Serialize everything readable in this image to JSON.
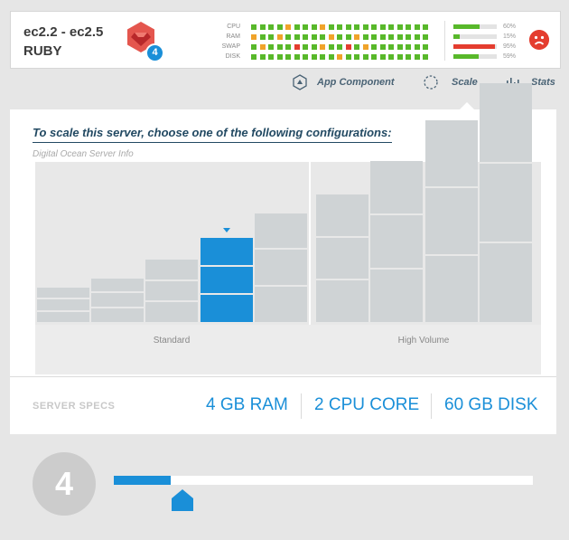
{
  "server": {
    "name": "ec2.2 - ec2.5",
    "language": "RUBY",
    "instance_count": "4"
  },
  "metrics": [
    {
      "label": "CPU",
      "dots": [
        "g",
        "g",
        "g",
        "g",
        "o",
        "g",
        "g",
        "g",
        "o",
        "g",
        "g",
        "g",
        "g",
        "g",
        "g",
        "g",
        "g",
        "g",
        "g",
        "g",
        "g"
      ]
    },
    {
      "label": "RAM",
      "dots": [
        "o",
        "g",
        "g",
        "o",
        "g",
        "g",
        "g",
        "g",
        "g",
        "o",
        "g",
        "g",
        "o",
        "g",
        "g",
        "g",
        "g",
        "g",
        "g",
        "g",
        "g"
      ]
    },
    {
      "label": "SWAP",
      "dots": [
        "g",
        "o",
        "g",
        "g",
        "g",
        "r",
        "g",
        "g",
        "o",
        "g",
        "g",
        "r",
        "g",
        "o",
        "g",
        "g",
        "g",
        "g",
        "g",
        "g",
        "g"
      ]
    },
    {
      "label": "DISK",
      "dots": [
        "g",
        "g",
        "g",
        "g",
        "g",
        "g",
        "g",
        "g",
        "g",
        "g",
        "o",
        "g",
        "g",
        "g",
        "g",
        "g",
        "g",
        "g",
        "g",
        "g",
        "g"
      ]
    }
  ],
  "usage": [
    {
      "label": "CPU",
      "pct_text": "60%",
      "value": 0.6,
      "color": "#58b82a"
    },
    {
      "label": "RAM",
      "pct_text": "15%",
      "value": 0.15,
      "color": "#58b82a"
    },
    {
      "label": "SWAP",
      "pct_text": "95%",
      "value": 0.95,
      "color": "#e43d2f"
    },
    {
      "label": "DISK",
      "pct_text": "59%",
      "value": 0.59,
      "color": "#58b82a"
    }
  ],
  "dot_colors": {
    "g": "#58b82a",
    "o": "#f0a32a",
    "r": "#e43d2f"
  },
  "status_icon": "sad-face-icon",
  "tabs": [
    {
      "label": "App Component",
      "icon": "hexagon-up-icon"
    },
    {
      "label": "Scale",
      "icon": "dashed-circle-icon",
      "active": true
    },
    {
      "label": "Stats",
      "icon": "bars-icon"
    }
  ],
  "scale": {
    "headline": "To scale this server, choose one of the following configurations:",
    "subhead": "Digital Ocean Server Info",
    "groups": [
      "Standard",
      "High Volume"
    ],
    "configs": [
      {
        "group": 0,
        "units": 3,
        "unit_height": 1.0
      },
      {
        "group": 0,
        "units": 3,
        "unit_height": 1.3
      },
      {
        "group": 0,
        "units": 3,
        "unit_height": 1.9
      },
      {
        "group": 0,
        "units": 3,
        "unit_height": 2.6,
        "selected": true
      },
      {
        "group": 0,
        "units": 3,
        "unit_height": 3.4
      },
      {
        "group": 1,
        "units": 3,
        "unit_height": 4.0
      },
      {
        "group": 1,
        "units": 3,
        "unit_height": 5.1
      },
      {
        "group": 1,
        "units": 3,
        "unit_height": 6.4
      },
      {
        "group": 1,
        "units": 3,
        "unit_height": 7.6
      }
    ],
    "selected_color": "#1a8fd8",
    "block_color": "#cfd3d5"
  },
  "specs": {
    "label": "SERVER SPECS",
    "ram": "4 GB RAM",
    "cpu": "2 CPU CORE",
    "disk": "60 GB DISK"
  },
  "slider": {
    "value": "4",
    "fraction": 0.135
  }
}
